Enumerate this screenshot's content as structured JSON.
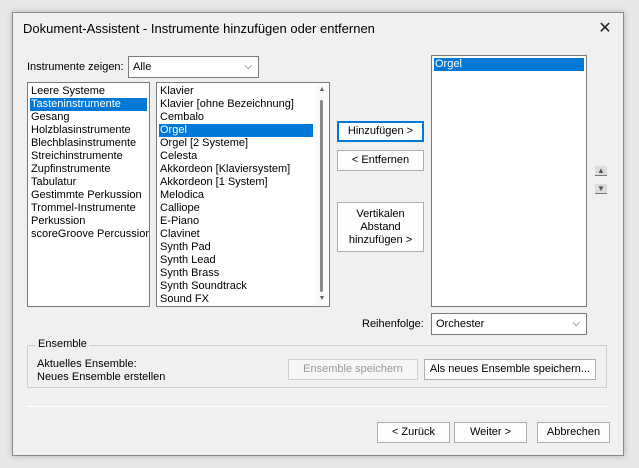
{
  "window": {
    "title": "Dokument-Assistent - Instrumente hinzufügen oder entfernen",
    "close_glyph": "✕"
  },
  "filter": {
    "label": "Instrumente zeigen:",
    "selected": "Alle"
  },
  "categories": [
    {
      "label": "Leere Systeme",
      "selected": false
    },
    {
      "label": "Tasteninstrumente",
      "selected": true
    },
    {
      "label": "Gesang",
      "selected": false
    },
    {
      "label": "Holzblasinstrumente",
      "selected": false
    },
    {
      "label": "Blechblasinstrumente",
      "selected": false
    },
    {
      "label": "Streichinstrumente",
      "selected": false
    },
    {
      "label": "Zupfinstrumente",
      "selected": false
    },
    {
      "label": "Tabulatur",
      "selected": false
    },
    {
      "label": "Gestimmte Perkussion",
      "selected": false
    },
    {
      "label": "Trommel-Instrumente",
      "selected": false
    },
    {
      "label": "Perkussion",
      "selected": false
    },
    {
      "label": "scoreGroove Percussion",
      "selected": false
    }
  ],
  "instruments": [
    {
      "label": "Klavier",
      "selected": false
    },
    {
      "label": "Klavier [ohne Bezeichnung]",
      "selected": false
    },
    {
      "label": "Cembalo",
      "selected": false
    },
    {
      "label": "Orgel",
      "selected": true
    },
    {
      "label": "Orgel [2 Systeme]",
      "selected": false
    },
    {
      "label": "Celesta",
      "selected": false
    },
    {
      "label": "Akkordeon [Klaviersystem]",
      "selected": false
    },
    {
      "label": "Akkordeon [1 System]",
      "selected": false
    },
    {
      "label": "Melodica",
      "selected": false
    },
    {
      "label": "Calliope",
      "selected": false
    },
    {
      "label": "E-Piano",
      "selected": false
    },
    {
      "label": "Clavinet",
      "selected": false
    },
    {
      "label": "Synth Pad",
      "selected": false
    },
    {
      "label": "Synth Lead",
      "selected": false
    },
    {
      "label": "Synth Brass",
      "selected": false
    },
    {
      "label": "Synth Soundtrack",
      "selected": false
    },
    {
      "label": "Sound FX",
      "selected": false
    }
  ],
  "actions": {
    "add_label": "Hinzufügen >",
    "remove_label": "< Entfernen",
    "add_spacing_label_line1": "Vertikalen",
    "add_spacing_label_line2": "Abstand",
    "add_spacing_label_line3": "hinzufügen >"
  },
  "selected_instruments": [
    {
      "label": "Orgel",
      "selected": true
    }
  ],
  "order": {
    "label": "Reihenfolge:",
    "selected": "Orchester"
  },
  "ensemble": {
    "title": "Ensemble",
    "current_label": "Aktuelles Ensemble:",
    "new_label": "Neues Ensemble erstellen",
    "save_label": "Ensemble speichern",
    "save_as_new_label": "Als neues Ensemble speichern..."
  },
  "footer": {
    "back_label": "< Zurück",
    "next_label": "Weiter >",
    "cancel_label": "Abbrechen"
  },
  "colors": {
    "selection": "#0078d7",
    "focus_border": "#0078d7"
  },
  "icons": {
    "close": "close-icon",
    "combo_arrow": "chevron-down-icon",
    "move_up": "arrow-up-icon",
    "move_down": "arrow-down-icon"
  }
}
